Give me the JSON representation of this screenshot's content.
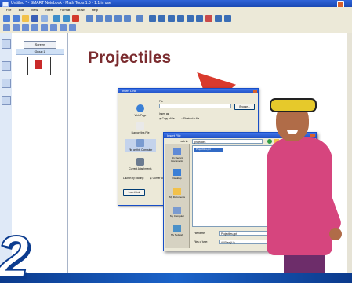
{
  "window": {
    "title": "Untitled * - SMART Notebook - Math Tools 1.0 - 1.1 in use",
    "icon": "notebook-app-icon"
  },
  "menu": [
    "File",
    "Edit",
    "View",
    "Insert",
    "Format",
    "Draw",
    "Help"
  ],
  "sorter": {
    "button_label": "Screen",
    "group_label": "Group 1"
  },
  "page": {
    "title": "Projectiles"
  },
  "insert_link_dialog": {
    "title": "Insert Link",
    "options": [
      "Web Page",
      "Support this File",
      "File on this Computer",
      "Current Attachments"
    ],
    "file_label": "File",
    "browse_label": "Browse...",
    "insert_as_label": "Insert as:",
    "copy_of_file": "Copy of file",
    "shortcut_to_file": "Shortcut to file",
    "launch_by_label": "Launch by clicking:",
    "corner_label": "Corner icon",
    "ok_label": "Insert Link"
  },
  "open_dialog": {
    "title": "Insert File",
    "look_in_label": "Look in:",
    "look_in_value": "projectiles",
    "files": [
      "Projectiles.ppt"
    ],
    "places": [
      "My Recent Documents",
      "Desktop",
      "My Documents",
      "My Computer",
      "My Network"
    ],
    "file_name_label": "File name:",
    "file_name_value": "Projectiles.ppt",
    "file_type_label": "Files of type:",
    "file_type_value": "All Files (*.*)",
    "open_label": "Open",
    "cancel_label": "Cancel"
  },
  "logo": {
    "digit": "2"
  },
  "colors": {
    "title": "#7b2c2f",
    "titlebar": "#1f50c4",
    "band": "#1b63c9"
  }
}
